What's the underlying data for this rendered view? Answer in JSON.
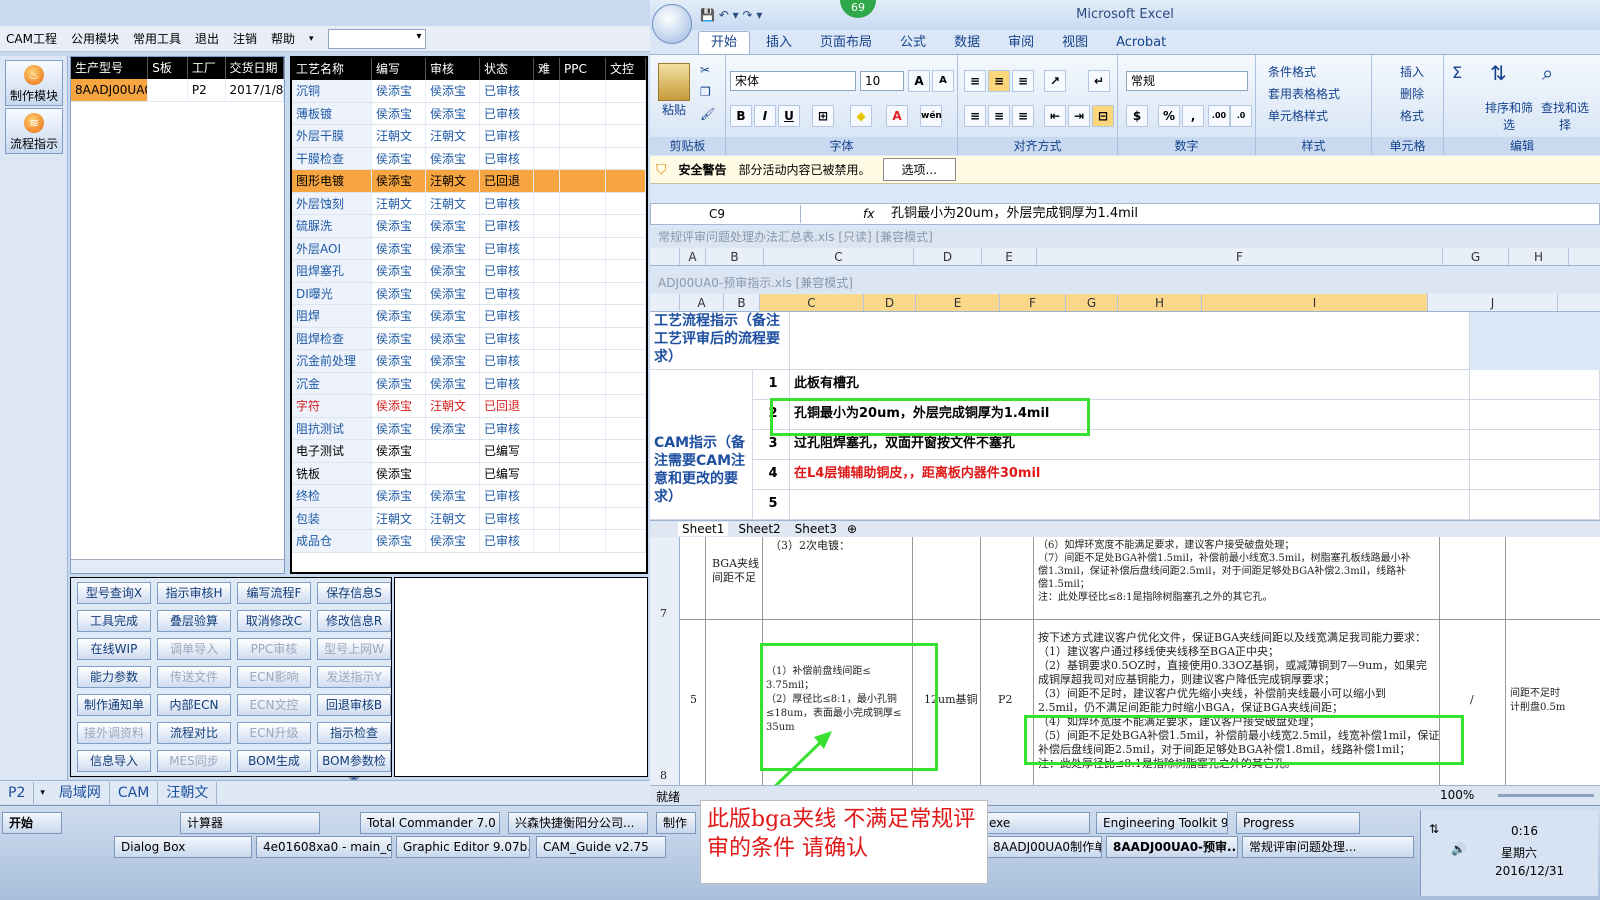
{
  "cam": {
    "menu": [
      "CAM工程",
      "公用模块",
      "常用工具",
      "退出",
      "注销",
      "帮助"
    ],
    "side": [
      "制作模块",
      "流程指示"
    ],
    "job": {
      "headers": [
        "生产型号",
        "S板",
        "工厂",
        "交货日期"
      ],
      "row": [
        "8AADJ00UA0",
        "",
        "P2",
        "2017/1/8"
      ]
    },
    "process": {
      "headers": [
        "工艺名称",
        "编写",
        "审核",
        "状态",
        "难",
        "PPC",
        "文控"
      ],
      "rows": [
        [
          "沉铜",
          "侯添宝",
          "侯添宝",
          "已审核"
        ],
        [
          "薄板镀",
          "侯添宝",
          "侯添宝",
          "已审核"
        ],
        [
          "外层干膜",
          "汪朝文",
          "汪朝文",
          "已审核"
        ],
        [
          "干膜检查",
          "侯添宝",
          "侯添宝",
          "已审核"
        ],
        [
          "图形电镀",
          "侯添宝",
          "汪朝文",
          "已回退"
        ],
        [
          "外层蚀刻",
          "汪朝文",
          "汪朝文",
          "已审核"
        ],
        [
          "硫脲洗",
          "侯添宝",
          "侯添宝",
          "已审核"
        ],
        [
          "外层AOI",
          "侯添宝",
          "侯添宝",
          "已审核"
        ],
        [
          "阻焊塞孔",
          "侯添宝",
          "侯添宝",
          "已审核"
        ],
        [
          "DI曝光",
          "侯添宝",
          "侯添宝",
          "已审核"
        ],
        [
          "阻焊",
          "侯添宝",
          "侯添宝",
          "已审核"
        ],
        [
          "阻焊检查",
          "侯添宝",
          "侯添宝",
          "已审核"
        ],
        [
          "沉金前处理",
          "侯添宝",
          "侯添宝",
          "已审核"
        ],
        [
          "沉金",
          "侯添宝",
          "侯添宝",
          "已审核"
        ],
        [
          "字符",
          "侯添宝",
          "汪朝文",
          "已回退"
        ],
        [
          "阻抗测试",
          "侯添宝",
          "侯添宝",
          "已审核"
        ],
        [
          "电子测试",
          "侯添宝",
          "",
          "已编写"
        ],
        [
          "铣板",
          "侯添宝",
          "",
          "已编写"
        ],
        [
          "终检",
          "侯添宝",
          "侯添宝",
          "已审核"
        ],
        [
          "包装",
          "汪朝文",
          "汪朝文",
          "已审核"
        ],
        [
          "成品仓",
          "侯添宝",
          "侯添宝",
          "已审核"
        ]
      ]
    },
    "buttons": [
      [
        "型号查询X",
        "指示审核H",
        "编写流程F",
        "保存信息S"
      ],
      [
        "工具完成",
        "叠层验算",
        "取消修改C",
        "修改信息R"
      ],
      [
        "在线WIP",
        "调单导入",
        "PPC审核",
        "型号上网W"
      ],
      [
        "能力参数",
        "传送文件",
        "ECN影响",
        "发送指示Y"
      ],
      [
        "制作通知单",
        "内部ECN",
        "ECN文控",
        "回退审核B"
      ],
      [
        "接外调资料",
        "流程对比",
        "ECN升级",
        "指示检查"
      ],
      [
        "信息导入",
        "MES同步",
        "BOM生成",
        "BOM参数检查"
      ]
    ],
    "status": [
      "P2",
      "局域网",
      "CAM",
      "汪朝文"
    ]
  },
  "excel": {
    "title": "Microsoft Excel",
    "badge": "69",
    "tabs": [
      "开始",
      "插入",
      "页面布局",
      "公式",
      "数据",
      "审阅",
      "视图",
      "Acrobat"
    ],
    "groups": [
      "剪贴板",
      "字体",
      "对齐方式",
      "数字",
      "样式",
      "单元格",
      "编辑"
    ],
    "paste": "粘贴",
    "font_name": "宋体",
    "font_size": "10",
    "num_fmt": "常规",
    "style_items": [
      "条件格式",
      "套用表格格式",
      "单元格样式"
    ],
    "cell_items": [
      "插入",
      "删除",
      "格式"
    ],
    "edit_items": [
      "排序和筛选",
      "查找和选择"
    ],
    "security": {
      "label": "安全警告",
      "msg": "部分活动内容已被禁用。",
      "btn": "选项..."
    },
    "namebox": "C9",
    "fx": "fx",
    "formula": "孔铜最小为20um，外层完成铜厚为1.4mil",
    "wb1": "常规评审问题处理办法汇总表.xls  [只读]  [兼容模式]",
    "wb2": "ADJ00UA0-预审指示.xls  [兼容模式]",
    "cols1": [
      "A",
      "B",
      "C",
      "D",
      "E",
      "F",
      "G",
      "H"
    ],
    "cols2": [
      "A",
      "B",
      "C",
      "D",
      "E",
      "F",
      "G",
      "H",
      "I",
      "J"
    ],
    "sec1": "工艺流程指示（备注工艺评审后的流程要求）",
    "sec2": "CAM指示（备注需要CAM注意和更改的要求）",
    "items": [
      [
        "1",
        "此板有槽孔"
      ],
      [
        "2",
        "孔铜最小为20um，外层完成铜厚为1.4mil"
      ],
      [
        "3",
        "过孔阻焊塞孔，双面开窗按文件不塞孔"
      ],
      [
        "4",
        "在L4层铺辅助铜皮，，距离板内器件30mil"
      ],
      [
        "5",
        ""
      ]
    ],
    "sheets": [
      "Sheet1",
      "Sheet2",
      "Sheet3"
    ],
    "lower": {
      "row7": "7",
      "row5": "5",
      "row8": "8",
      "bga": "BGA夹线\n间距不足",
      "plating": "（3）2次电镀：",
      "n6": "（6）如焊环宽度不能满足要求，建议客户接受破盘处理；\n（7）间距不足处BGA补偿1.5mil，补偿前最小线宽3.5mil，树脂塞孔板线路最小补\n偿1.3mil，保证补偿后盘线间距2.5mil，对于间距足够处BGA补偿2.3mil，线路补\n偿1.5mil；\n注：此处厚径比≤8:1是指除树脂塞孔之外的其它孔。",
      "left": "（1）补偿前盘线间距≤\n3.75mil；\n（2）厚径比≤8:1，最小孔铜\n≤18um，表面最小完成铜厚≤\n35um",
      "cu": "12um基铜",
      "p2": "P2",
      "slash": "/",
      "right": "按下述方式建议客户优化文件，保证BGA夹线间距以及线宽满足我司能力要求：\n（1）建议客户通过移线使夹线移至BGA正中央；\n（2）基铜要求0.5OZ时，直接使用0.33OZ基铜，或减薄铜到7—9um，如果完\n成铜厚超我司对应基铜能力，则建议客户降低完成铜厚要求；\n（3）间距不足时，建议客户优先缩小夹线，补偿前夹线最小可以缩小到\n2.5mil，仍不满足间距能力时缩小BGA，保证BGA夹线间距；\n（4）如焊环宽度不能满足要求，建议客户接受破盘处理；\n（5）间距不足处BGA补偿1.5mil，补偿前最小线宽2.5mil，线宽补偿1mil，保证\n补偿后盘线间距2.5mil，对于间距足够处BGA补偿1.8mil，线路补偿1mil；\n注：此处厚径比≤8:1是指除树脂塞孔之外的其它孔。",
      "edge": "间距不足时\n计削盘0.5m"
    },
    "status": {
      "ready": "就绪",
      "zoom": "100%"
    }
  },
  "callout": "此版bga夹线  不满足常规评审的条件  请确认",
  "taskbar": {
    "start": "开始",
    "row1": [
      "计算器",
      "Total Commander 7.0 ...",
      "兴森快捷衡阳分公司...",
      "制作",
      "exe",
      "Engineering Toolkit 9....",
      "Progress"
    ],
    "row2": [
      "Dialog Box",
      "4e01608xa0 - main_qa",
      "Graphic Editor 9.07b...",
      "CAM_Guide v2.75",
      "8AADJ00UA0制作单...",
      "8AADJ00UA0-预审...",
      "常规评审问题处理..."
    ],
    "time": "0:16",
    "day": "星期六",
    "date": "2016/12/31"
  }
}
